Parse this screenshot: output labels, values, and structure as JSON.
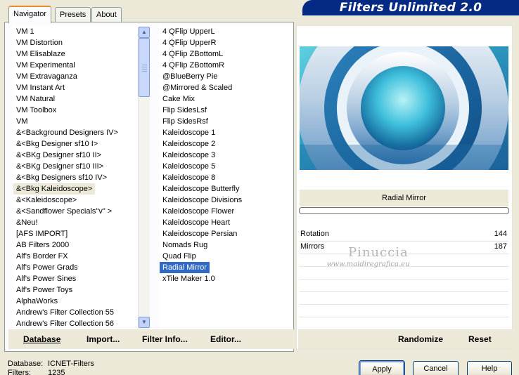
{
  "tabs": [
    {
      "label": "Navigator",
      "active": true
    },
    {
      "label": "Presets",
      "active": false
    },
    {
      "label": "About",
      "active": false
    }
  ],
  "banner": {
    "title": "Filters Unlimited 2.0"
  },
  "categories": {
    "items": [
      "VM 1",
      "VM Distortion",
      "VM Elisablaze",
      "VM Experimental",
      "VM Extravaganza",
      "VM Instant Art",
      "VM Natural",
      "VM Toolbox",
      "VM",
      "&<Background Designers IV>",
      "&<Bkg Designer sf10 I>",
      "&<BKg Designer sf10 II>",
      "&<BKg Designer sf10 III>",
      "&<Bkg Designers sf10 IV>",
      "&<Bkg Kaleidoscope>",
      "&<Kaleidoscope>",
      "&<Sandflower Specials\"v\" >",
      "&Neu!",
      "[AFS IMPORT]",
      "AB Filters 2000",
      "Alf's Border FX",
      "Alf's Power Grads",
      "Alf's Power Sines",
      "Alf's Power Toys",
      "AlphaWorks",
      "Andrew's Filter Collection 55",
      "Andrew's Filter Collection 56"
    ],
    "selected_index": 14
  },
  "filters": {
    "items": [
      "4 QFlip UpperL",
      "4 QFlip UpperR",
      "4 QFlip ZBottomL",
      "4 QFlip ZBottomR",
      "@BlueBerry Pie",
      "@Mirrored & Scaled",
      "Cake Mix",
      "Flip SidesLsf",
      "Flip SidesRsf",
      "Kaleidoscope 1",
      "Kaleidoscope 2",
      "Kaleidoscope 3",
      "Kaleidoscope 5",
      "Kaleidoscope 8",
      "Kaleidoscope Butterfly",
      "Kaleidoscope Divisions",
      "Kaleidoscope Flower",
      "Kaleidoscope Heart",
      "Kaleidoscope Persian",
      "Nomads Rug",
      "Quad Flip",
      "Radial Mirror",
      "xTile Maker 1.0"
    ],
    "selected_index": 21
  },
  "toolbar": {
    "database": "Database",
    "import": "Import...",
    "filter_info": "Filter Info...",
    "editor": "Editor..."
  },
  "filter_panel": {
    "name": "Radial Mirror",
    "params": [
      {
        "label": "Rotation",
        "value": "144"
      },
      {
        "label": "Mirrors",
        "value": "187"
      }
    ],
    "watermark": "Pinuccia",
    "watermark_url": "www.maidiregrafica.eu"
  },
  "right_buttons": {
    "randomize": "Randomize",
    "reset": "Reset"
  },
  "status": {
    "database_label": "Database:",
    "database_value": "ICNET-Filters",
    "filters_label": "Filters:",
    "filters_value": "1235"
  },
  "dialog_buttons": {
    "apply": "Apply",
    "cancel": "Cancel",
    "help": "Help"
  },
  "colors": {
    "banner": "#052a83",
    "selection": "#316ac5",
    "dialog_bg": "#ece9d8",
    "tab_highlight": "#e68b2c"
  },
  "icons": {
    "scroll_up": "chevron-up-icon",
    "scroll_down": "chevron-down-icon"
  }
}
